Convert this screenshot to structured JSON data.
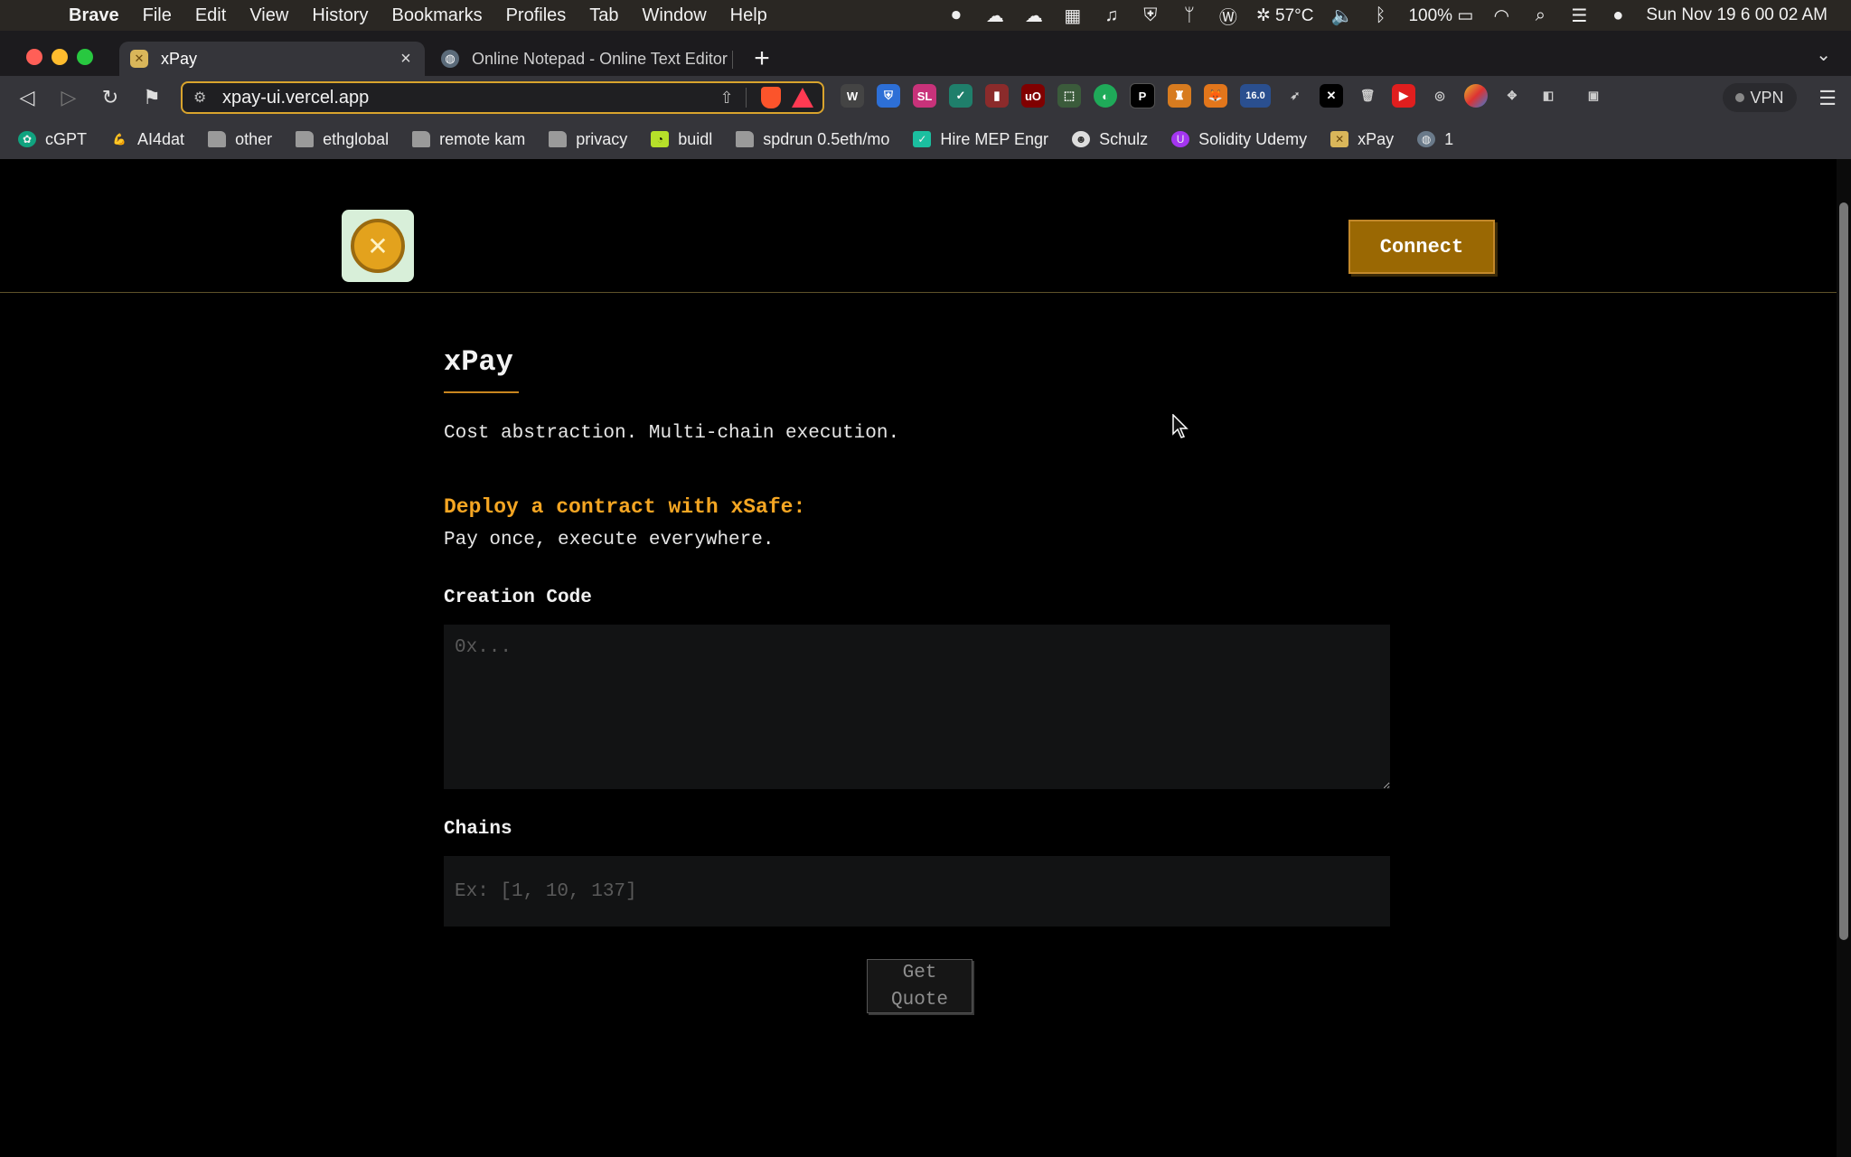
{
  "menubar": {
    "app": "Brave",
    "items": [
      "File",
      "Edit",
      "View",
      "History",
      "Bookmarks",
      "Profiles",
      "Tab",
      "Window",
      "Help"
    ],
    "temperature": "57°C",
    "battery": "100%",
    "clock": "Sun Nov 19  6 00 02 AM"
  },
  "tabs": [
    {
      "title": "xPay"
    },
    {
      "title": "Online Notepad - Online Text Editor"
    }
  ],
  "address": {
    "url": "xpay-ui.vercel.app"
  },
  "extensions": {
    "badge": "16.0"
  },
  "vpn_label": "VPN",
  "bookmarks": [
    "cGPT",
    "AI4dat",
    "other",
    "ethglobal",
    "remote kam",
    "privacy",
    "buidl",
    "spdrun 0.5eth/mo",
    "Hire MEP Engr",
    "Schulz",
    "Solidity Udemy",
    "xPay",
    "1"
  ],
  "site": {
    "connect_label": "Connect",
    "title": "xPay",
    "tagline": "Cost abstraction. Multi-chain execution.",
    "deploy_heading": "Deploy a contract with xSafe:",
    "deploy_sub": "Pay once, execute everywhere.",
    "creation_code_label": "Creation Code",
    "creation_code_placeholder": "0x...",
    "chains_label": "Chains",
    "chains_placeholder": "Ex: [1, 10, 137]",
    "quote_label": "Get Quote"
  },
  "colors": {
    "accent": "#f5a623",
    "connect_bg": "#9a6803",
    "url_border": "#d9a42d"
  }
}
